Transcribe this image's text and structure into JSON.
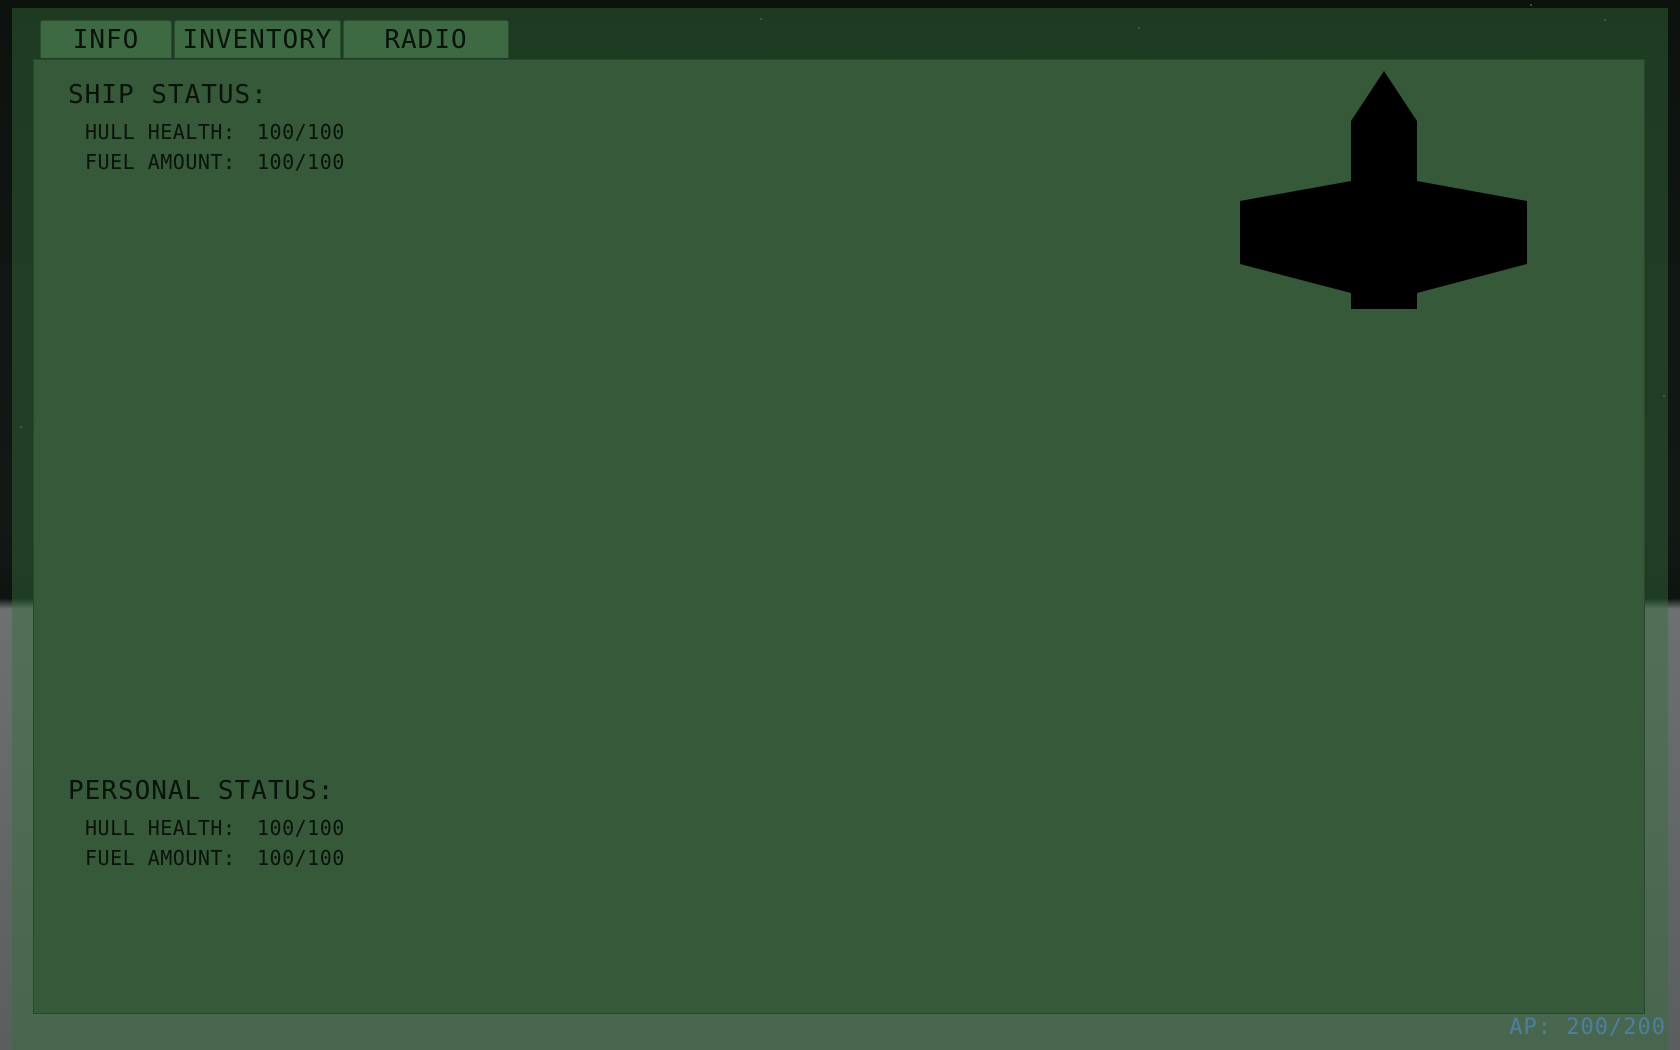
{
  "tabs": {
    "info": "INFO",
    "inventory": "INVENTORY",
    "radio": "RADIO"
  },
  "ship_status": {
    "title": "SHIP STATUS:",
    "hull_label": "HULL HEALTH:",
    "hull_value": "100/100",
    "fuel_label": "FUEL AMOUNT:",
    "fuel_value": "100/100"
  },
  "personal_status": {
    "title": "PERSONAL STATUS:",
    "hull_label": "HULL HEALTH:",
    "hull_value": "100/100",
    "fuel_label": "FUEL AMOUNT:",
    "fuel_value": "100/100"
  },
  "hud": {
    "ap": "AP: 200/200"
  },
  "colors": {
    "panel": "#365939",
    "tab": "#3d6a43",
    "text": "#0a120b",
    "ap_text": "#4d7fa3",
    "ship_silhouette": "#000000"
  },
  "icons": {
    "ship": "ship-silhouette-icon"
  }
}
